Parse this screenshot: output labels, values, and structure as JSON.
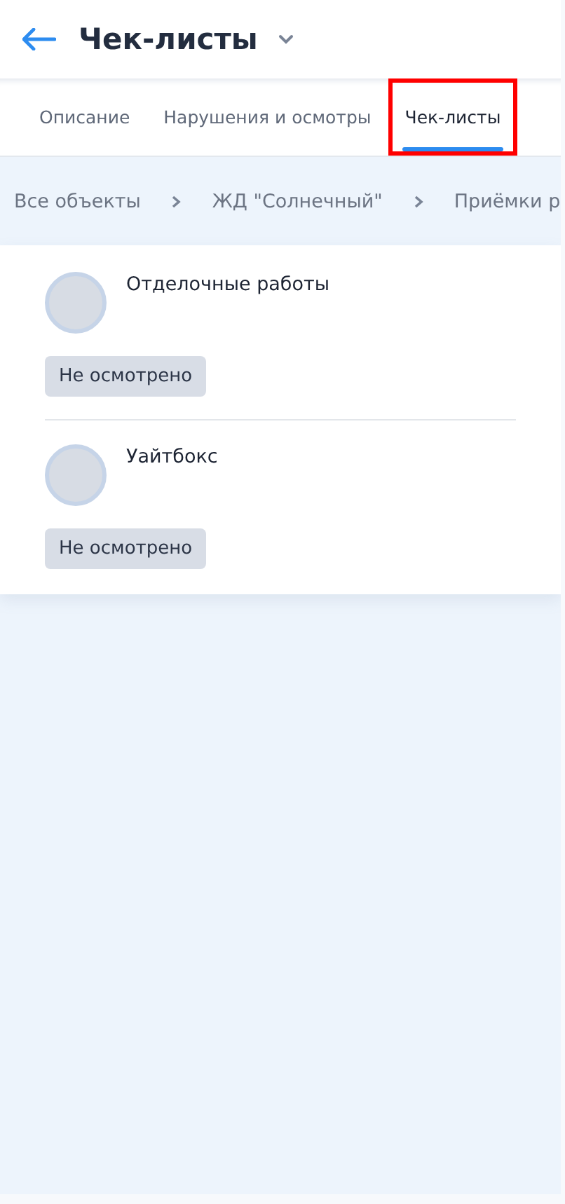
{
  "header": {
    "title": "Чек-листы"
  },
  "tabs": [
    {
      "label": "Описание",
      "selected": false,
      "highlighted": false
    },
    {
      "label": "Нарушения и осмотры",
      "selected": false,
      "highlighted": false
    },
    {
      "label": "Чек-листы",
      "selected": true,
      "highlighted": true
    }
  ],
  "breadcrumbs": [
    "Все объекты",
    "ЖД \"Солнечный\"",
    "Приёмки р"
  ],
  "checklists": [
    {
      "name": "Отделочные работы",
      "status": "Не осмотрено"
    },
    {
      "name": "Уайтбокс",
      "status": "Не осмотрено"
    }
  ]
}
